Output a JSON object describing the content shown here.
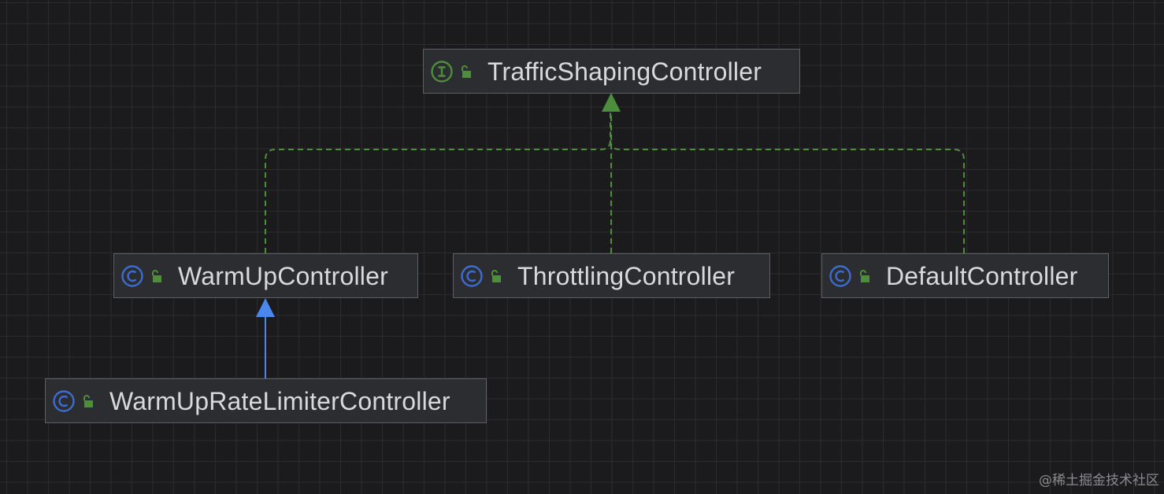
{
  "colors": {
    "background": "#1b1b1d",
    "node_fill": "#2b2d30",
    "node_border": "#5d5f63",
    "node_text": "#d7d9dc",
    "implements_edge": "#4e8d3b",
    "extends_edge": "#4a88f0",
    "interface_icon": "#4e8d3b",
    "class_icon": "#3d6cd1",
    "lock_icon": "#4e8d3b"
  },
  "nodes": {
    "traffic_shaping": {
      "label": "TrafficShapingController",
      "kind": "interface",
      "icon_name": "interface-icon",
      "visibility_icon": "unlocked-lock-icon"
    },
    "warm_up": {
      "label": "WarmUpController",
      "kind": "class",
      "icon_name": "class-icon",
      "visibility_icon": "unlocked-lock-icon"
    },
    "throttling": {
      "label": "ThrottlingController",
      "kind": "class",
      "icon_name": "class-icon",
      "visibility_icon": "unlocked-lock-icon"
    },
    "default": {
      "label": "DefaultController",
      "kind": "class",
      "icon_name": "class-icon",
      "visibility_icon": "unlocked-lock-icon"
    },
    "warm_up_rate_limiter": {
      "label": "WarmUpRateLimiterController",
      "kind": "class",
      "icon_name": "class-icon",
      "visibility_icon": "unlocked-lock-icon"
    }
  },
  "edges": [
    {
      "from": "warm_up",
      "to": "traffic_shaping",
      "relation": "implements",
      "style": "dashed"
    },
    {
      "from": "throttling",
      "to": "traffic_shaping",
      "relation": "implements",
      "style": "dashed"
    },
    {
      "from": "default",
      "to": "traffic_shaping",
      "relation": "implements",
      "style": "dashed"
    },
    {
      "from": "warm_up_rate_limiter",
      "to": "warm_up",
      "relation": "extends",
      "style": "solid"
    }
  ],
  "watermark": "@稀土掘金技术社区"
}
